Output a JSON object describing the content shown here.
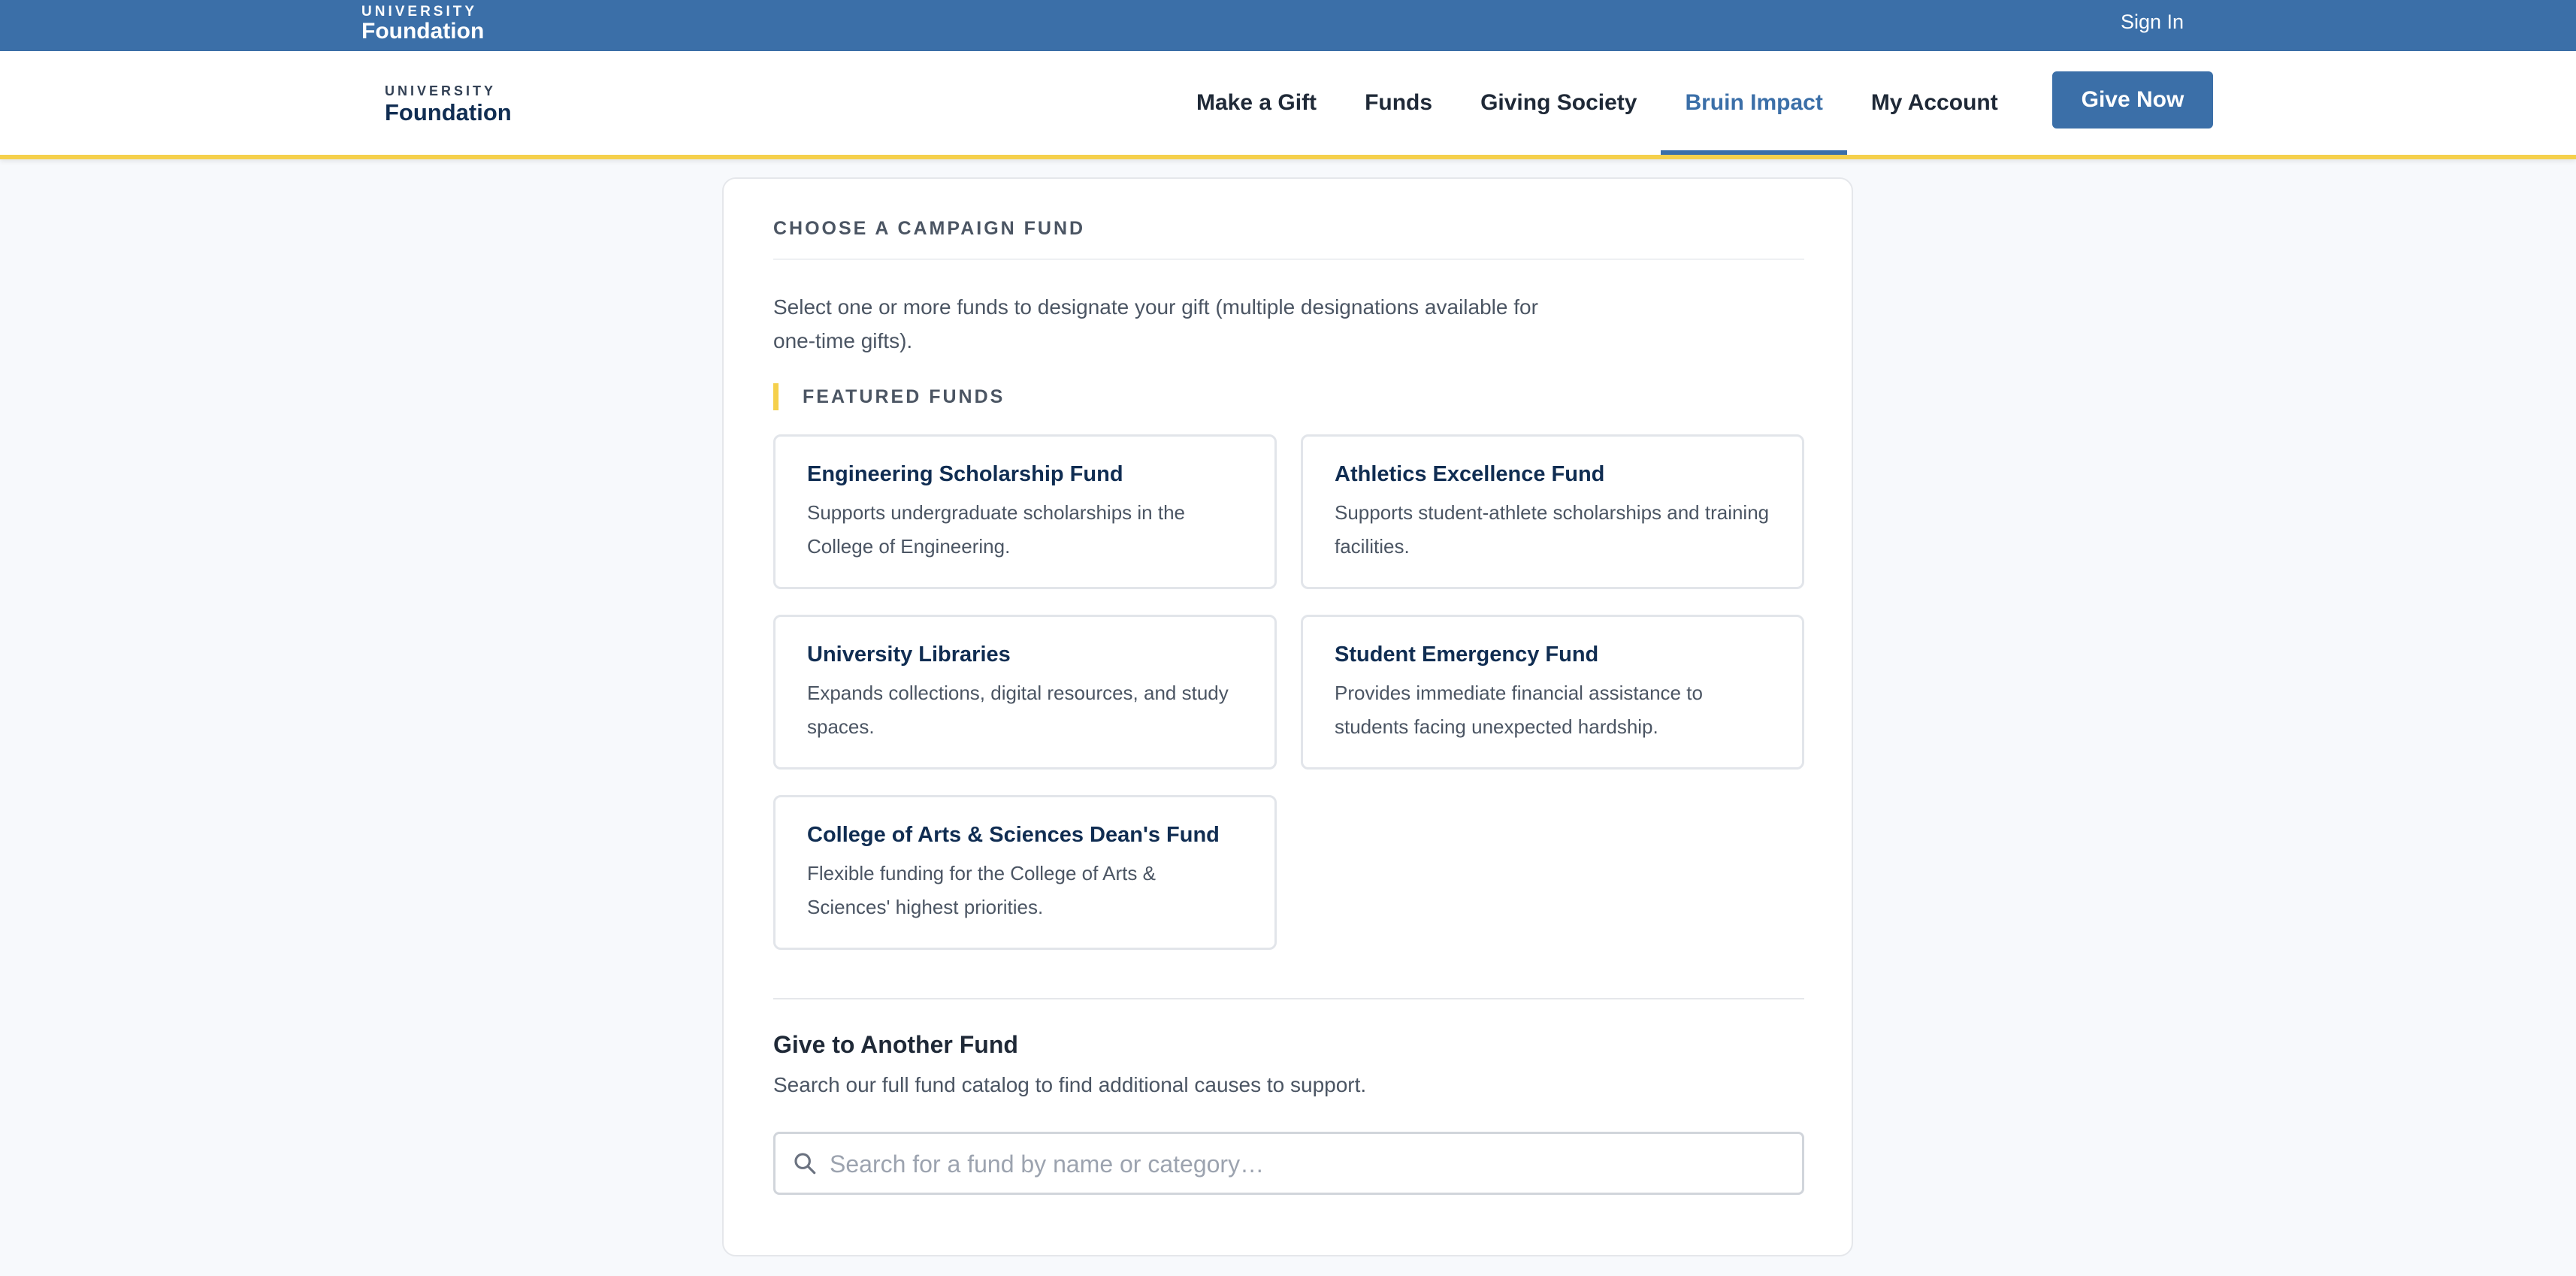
{
  "topbar": {
    "logo_small": "UNIVERSITY",
    "logo_big": "Foundation",
    "sign_in": "Sign In"
  },
  "nav": {
    "logo_small": "UNIVERSITY",
    "logo_big": "Foundation",
    "links": [
      {
        "label": "Make a Gift"
      },
      {
        "label": "Funds"
      },
      {
        "label": "Giving Society"
      },
      {
        "label": "Bruin Impact"
      },
      {
        "label": "My Account"
      }
    ],
    "active_link": "Bruin Impact",
    "give_now": "Give Now"
  },
  "campaign": {
    "section_label": "CHOOSE A CAMPAIGN FUND",
    "intro": "Select one or more funds to designate your gift (multiple designations available for one-time gifts).",
    "featured_label": "FEATURED FUNDS",
    "funds": [
      {
        "title": "Engineering Scholarship Fund",
        "description": "Supports undergraduate scholarships in the College of Engineering."
      },
      {
        "title": "Athletics Excellence Fund",
        "description": "Supports student-athlete scholarships and training facilities."
      },
      {
        "title": "University Libraries",
        "description": "Expands collections, digital resources, and study spaces."
      },
      {
        "title": "Student Emergency Fund",
        "description": "Provides immediate financial assistance to students facing unexpected hardship."
      },
      {
        "title": "College of Arts & Sciences Dean's Fund",
        "description": "Flexible funding for the College of Arts & Sciences' highest priorities."
      }
    ],
    "other_fund": {
      "title": "Give to Another Fund",
      "description": "Search our full fund catalog to find additional causes to support.",
      "search_placeholder": "Search for a fund by name or category…",
      "search_value": ""
    }
  },
  "colors": {
    "brand_blue": "#3b6fa8",
    "accent_gold": "#f5d04c",
    "navy_text": "#102d52"
  }
}
